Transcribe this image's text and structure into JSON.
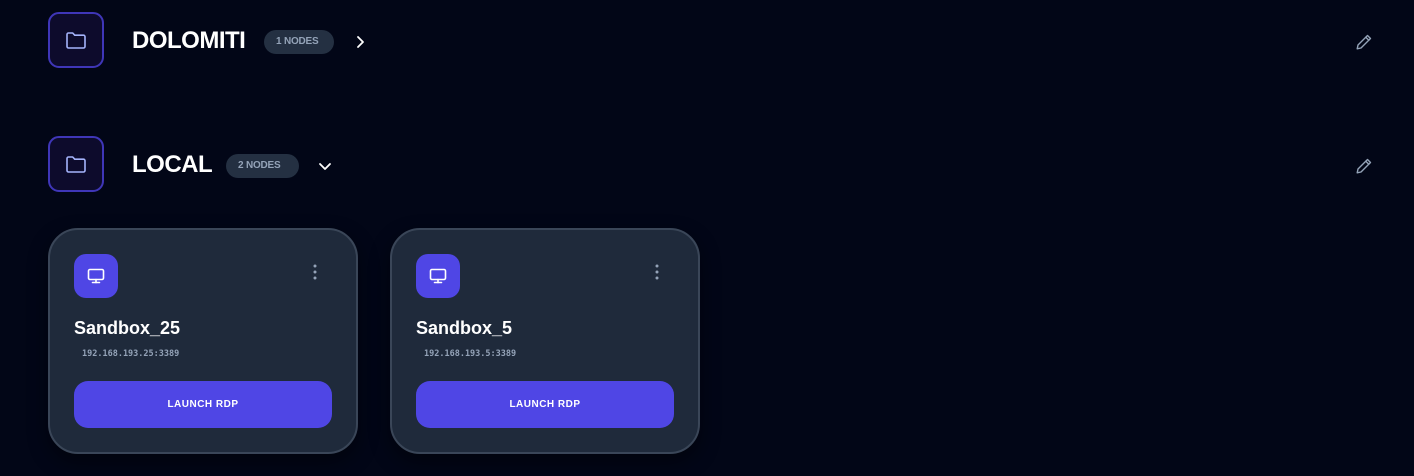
{
  "groups": [
    {
      "title": "DOLOMITI",
      "badge": "1 NODES",
      "expanded": false,
      "chevron_icon": "chevron-right-icon",
      "folder_icon": "folder-icon",
      "edit_icon": "pencil-icon"
    },
    {
      "title": "LOCAL",
      "badge": "2 NODES",
      "expanded": true,
      "chevron_icon": "chevron-down-icon",
      "folder_icon": "folder-icon",
      "edit_icon": "pencil-icon",
      "nodes": [
        {
          "name": "Sandbox_25",
          "address": "192.168.193.25:3389",
          "button_label": "LAUNCH RDP",
          "icon": "monitor-icon",
          "menu_icon": "more-vertical-icon"
        },
        {
          "name": "Sandbox_5",
          "address": "192.168.193.5:3389",
          "button_label": "LAUNCH RDP",
          "icon": "monitor-icon",
          "menu_icon": "more-vertical-icon"
        }
      ]
    }
  ],
  "colors": {
    "background": "#020617",
    "accent": "#4f46e5",
    "card": "#1f2a3b",
    "badge": "#243042",
    "muted_text": "#94a3b8"
  }
}
